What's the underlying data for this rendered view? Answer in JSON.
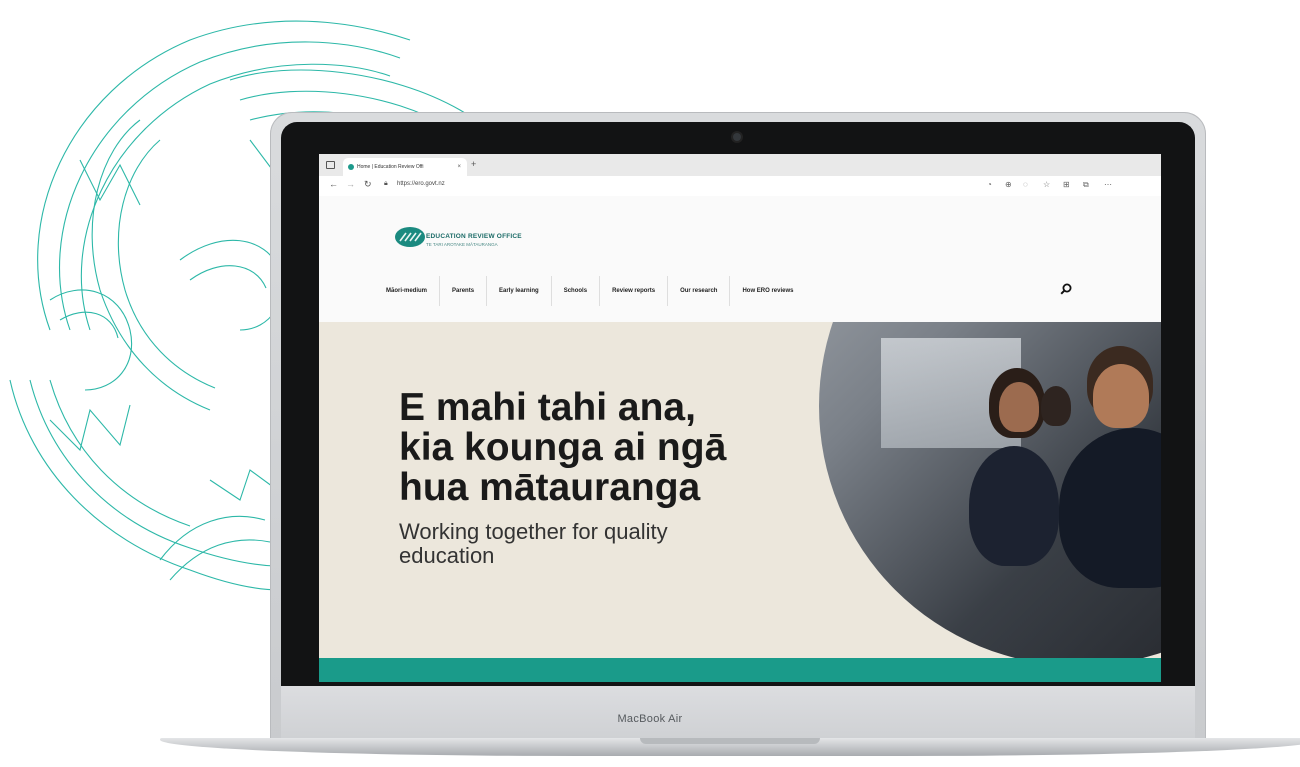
{
  "laptop": {
    "brand_label": "MacBook Air"
  },
  "browser": {
    "tab_title": "Home | Education Review Offi",
    "tab_close": "×",
    "new_tab": "+",
    "url": "https://ero.govt.nz"
  },
  "site": {
    "logo_title": "EDUCATION REVIEW OFFICE",
    "logo_subtitle": "TE TARI AROTAKE MĀTAURANGA",
    "nav": [
      {
        "label": "Māori-medium"
      },
      {
        "label": "Parents"
      },
      {
        "label": "Early learning"
      },
      {
        "label": "Schools"
      },
      {
        "label": "Review reports"
      },
      {
        "label": "Our research"
      },
      {
        "label": "How ERO reviews"
      }
    ],
    "hero": {
      "heading": "E mahi tahi ana,\nkia kounga ai ngā\nhua mātauranga",
      "subheading": "Working together for quality\neducation"
    }
  },
  "colors": {
    "teal": "#1a9b8a",
    "hero_bg": "#ece7dc",
    "koru_line": "#2db8a8"
  },
  "icons": [
    "koru-pattern-icon",
    "window-icon",
    "back-icon",
    "forward-icon",
    "refresh-icon",
    "lock-icon",
    "search-icon",
    "ero-logo"
  ]
}
